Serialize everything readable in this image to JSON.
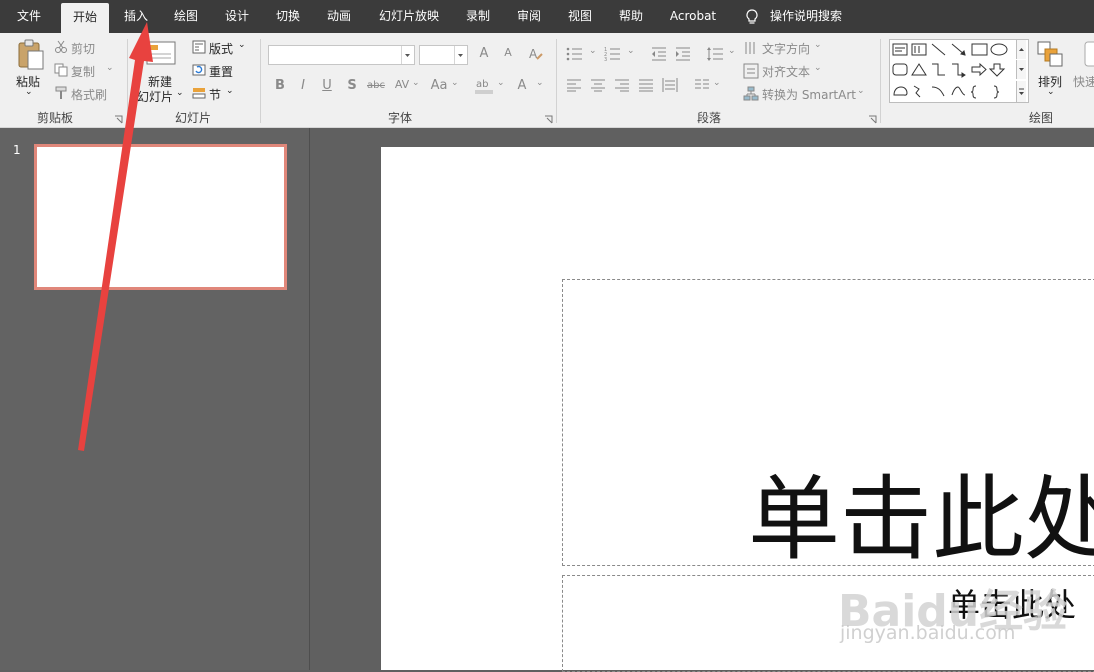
{
  "tabs": [
    {
      "label": "文件"
    },
    {
      "label": "开始"
    },
    {
      "label": "插入"
    },
    {
      "label": "绘图"
    },
    {
      "label": "设计"
    },
    {
      "label": "切换"
    },
    {
      "label": "动画"
    },
    {
      "label": "幻灯片放映"
    },
    {
      "label": "录制"
    },
    {
      "label": "审阅"
    },
    {
      "label": "视图"
    },
    {
      "label": "帮助"
    },
    {
      "label": "Acrobat"
    },
    {
      "label": "操作说明搜索"
    }
  ],
  "active_tab": "开始",
  "clipboard": {
    "paste": "粘贴",
    "cut": "剪切",
    "copy": "复制",
    "format_painter": "格式刷",
    "group": "剪贴板"
  },
  "slides": {
    "new_slide_line1": "新建",
    "new_slide_line2": "幻灯片",
    "layout": "版式",
    "reset": "重置",
    "section": "节",
    "group": "幻灯片"
  },
  "font": {
    "font_name": "",
    "font_size": "",
    "bold": "B",
    "italic": "I",
    "underline": "U",
    "shadow": "S",
    "strike": "abc",
    "spacing": "AV",
    "case": "Aa",
    "color": "A",
    "grow": "A",
    "shrink": "A",
    "group": "字体"
  },
  "paragraph": {
    "text_direction": "文字方向",
    "align_text": "对齐文本",
    "smartart": "转换为 SmartArt",
    "group": "段落"
  },
  "drawing": {
    "arrange": "排列",
    "quick_styles": "快速",
    "group": "绘图"
  },
  "thumbnail": {
    "number": "1"
  },
  "slide": {
    "title_placeholder": "单击此处",
    "subtitle_placeholder": "单击此处"
  },
  "watermark": {
    "brand": "Baidu经验",
    "url": "jingyan.baidu.com"
  },
  "annotation": {
    "arrow_color": "#e8423f"
  },
  "colors": {
    "tab_bar": "#3b3b3b",
    "ribbon": "#f0f0f0",
    "workspace": "#606060",
    "thumbnail_border": "#e0877a"
  }
}
